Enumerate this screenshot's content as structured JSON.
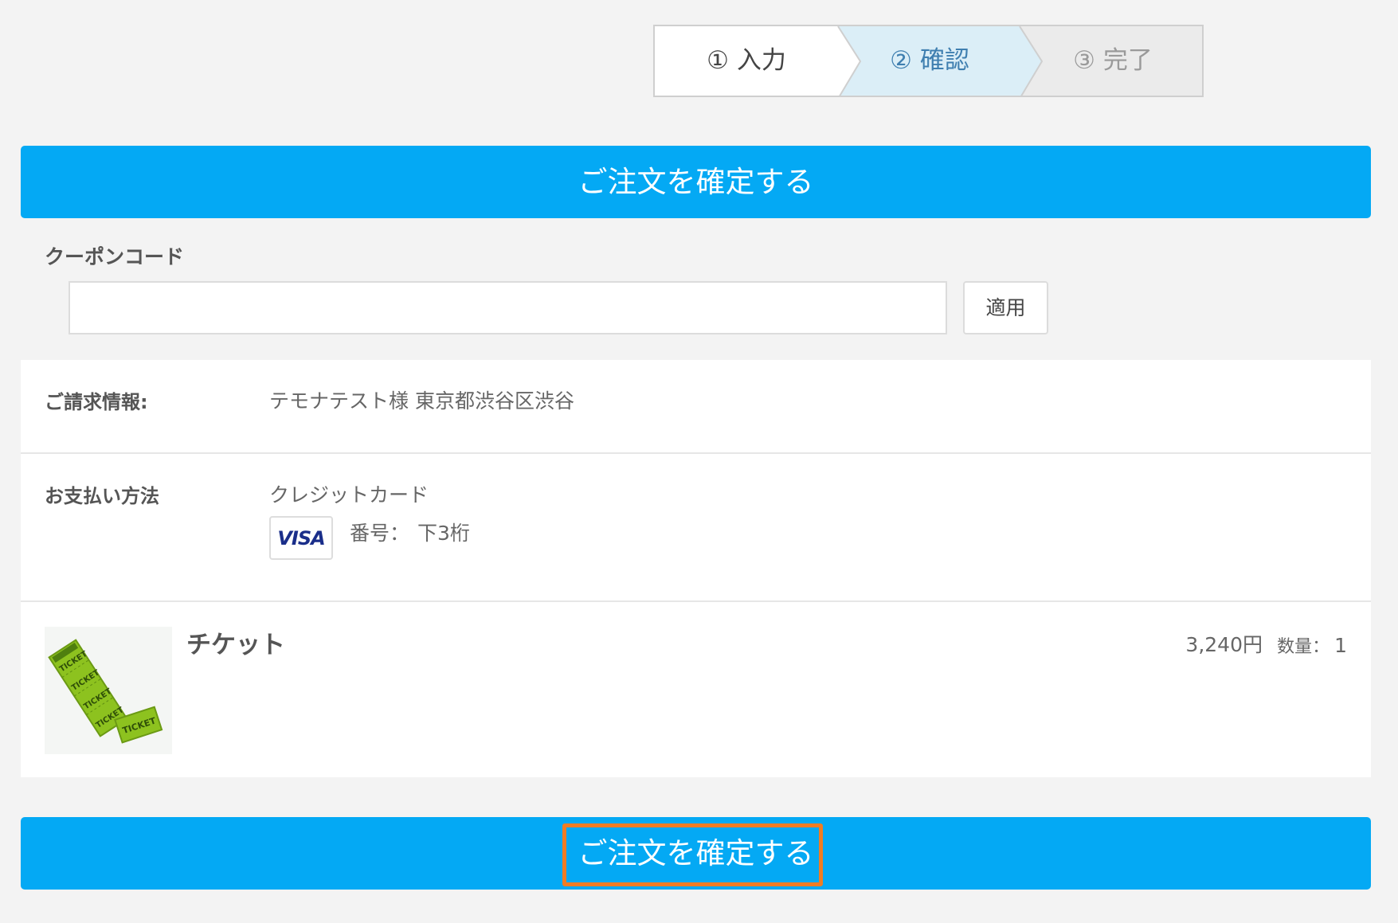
{
  "steps": [
    {
      "label": "① 入力",
      "state": "done"
    },
    {
      "label": "② 確認",
      "state": "current"
    },
    {
      "label": "③ 完了",
      "state": "upcoming"
    }
  ],
  "confirm_button": {
    "label": "ご注文を確定する"
  },
  "coupon": {
    "label": "クーポンコード",
    "value": "",
    "placeholder": "",
    "apply_label": "適用"
  },
  "billing": {
    "label": "ご請求情報:",
    "value": "テモナテスト様 東京都渋谷区渋谷"
  },
  "payment": {
    "label": "お支払い方法",
    "method": "クレジットカード",
    "card_brand": "VISA",
    "card_number_label": "番号：",
    "card_number_value": "下3桁"
  },
  "product": {
    "name": "チケット",
    "image_text": "TICKET",
    "price": "3,240円",
    "qty_label": "数量：",
    "qty_value": "1"
  },
  "colors": {
    "primary": "#04a9f4",
    "highlight": "#f07c22",
    "step_current_bg": "#dbeef7",
    "step_upcoming_bg": "#ebebeb",
    "ticket_green": "#8dc21f"
  }
}
